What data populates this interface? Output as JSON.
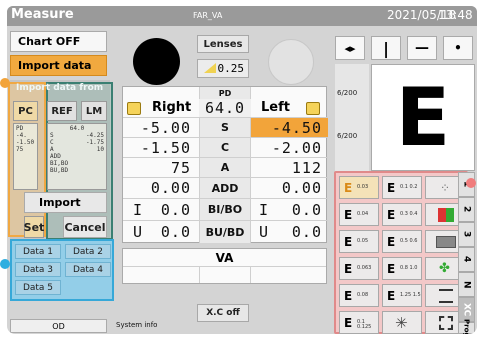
{
  "title_bar": {
    "app": "Measure",
    "file": "FAR_VA",
    "date": "2021/05/18",
    "time": "13:48"
  },
  "left": {
    "chart_off": "Chart OFF",
    "import_data": "Import data",
    "import_from_label": "Import data from",
    "sources": [
      "PC",
      "REF",
      "LM"
    ],
    "pc_list": [
      "PD",
      "-4.",
      "-1.50",
      "75"
    ],
    "ref_header": "64.0",
    "ref_rows": [
      {
        "k": "S",
        "v": "-4.25"
      },
      {
        "k": "C",
        "v": "-1.75"
      },
      {
        "k": "A",
        "v": "10"
      },
      {
        "k": "ADD",
        "v": ""
      },
      {
        "k": "BI,BO",
        "v": ""
      },
      {
        "k": "BU,BD",
        "v": ""
      }
    ],
    "import_button": "Import",
    "set_button": "Set",
    "cancel_button": "Cancel",
    "data_buttons": [
      "Data 1",
      "Data 2",
      "Data 3",
      "Data 4",
      "Data 5"
    ],
    "od_button": "OD"
  },
  "center": {
    "lenses": "Lenses",
    "lens_value": "0.25",
    "pd_label": "PD",
    "right_header": "Right",
    "pd_value": "64.0",
    "left_header": "Left",
    "rows": [
      {
        "label": "S",
        "right": "-5.00",
        "left": "-4.50",
        "left_active": true
      },
      {
        "label": "C",
        "right": "-1.50",
        "left": "-2.00"
      },
      {
        "label": "A",
        "right": "75",
        "left": "112"
      },
      {
        "label": "ADD",
        "right": "0.00",
        "left": "0.00"
      },
      {
        "label": "BI/BO",
        "right_prefix": "I",
        "right": "0.0",
        "left_prefix": "I",
        "left": "0.0"
      },
      {
        "label": "BU/BD",
        "right_prefix": "U",
        "right": "0.0",
        "left_prefix": "U",
        "left": "0.0"
      }
    ],
    "va_label": "VA",
    "xc_button": "X.C off",
    "system_info": "System info"
  },
  "right": {
    "nav": [
      "◂▸",
      "|",
      "—",
      "•"
    ],
    "acuity": [
      "6/200",
      "6/200"
    ],
    "optotype": "E",
    "chart_buttons": [
      {
        "label": "0.03",
        "active": true
      },
      {
        "label": "0.1 0.2"
      },
      {
        "label": ""
      },
      {
        "label": "0.04"
      },
      {
        "label": "0.3 0.4"
      },
      {
        "label": ""
      },
      {
        "label": "0.05"
      },
      {
        "label": "0.5 0.6"
      },
      {
        "label": ""
      },
      {
        "label": "0.063"
      },
      {
        "label": "0.8 1.0"
      },
      {
        "label": ""
      },
      {
        "label": "0.08"
      },
      {
        "label": "1.25 1.5"
      },
      {
        "label": ""
      },
      {
        "label": "0.1 0.125"
      },
      {
        "label": "1.5 2.0"
      },
      {
        "label": ""
      }
    ],
    "tabs": [
      "1",
      "2",
      "3",
      "4",
      "N",
      "XC",
      "Prog"
    ]
  }
}
